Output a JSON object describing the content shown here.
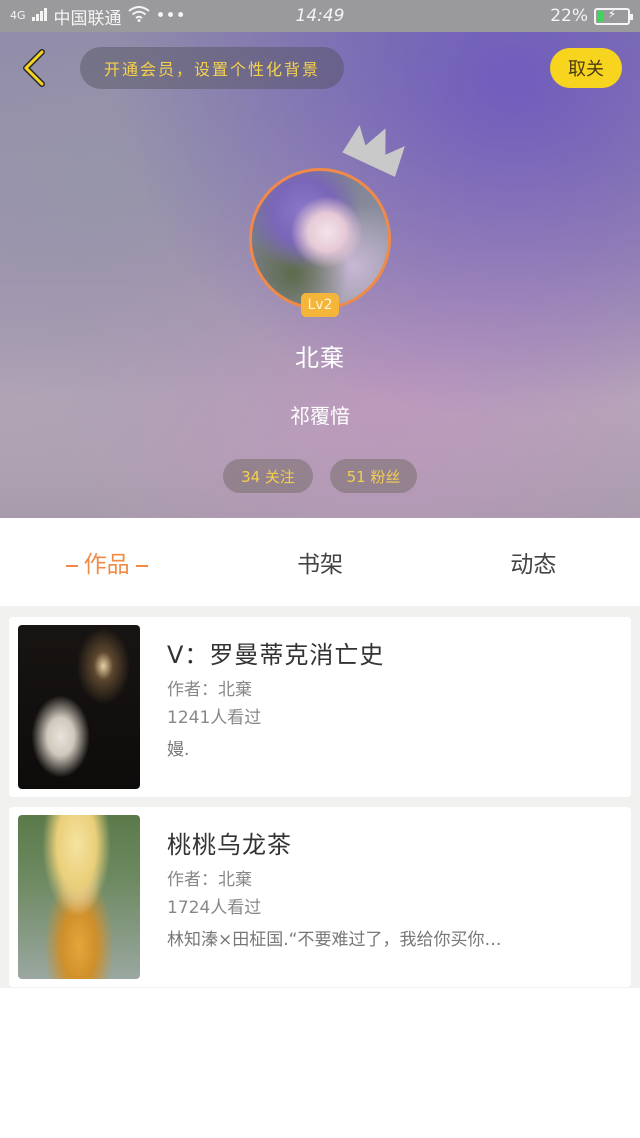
{
  "status_bar": {
    "network": "4G",
    "carrier": "中国联通",
    "more": "•••",
    "time": "14:49",
    "battery_percent": "22%",
    "battery_level": 0.22
  },
  "header": {
    "vip_banner": "开通会员，设置个性化背景",
    "unfollow_label": "取关",
    "level": "Lv2",
    "username": "北棄",
    "signature": "祁覆愔",
    "following": "34 关注",
    "fans": "51 粉丝"
  },
  "tabs": [
    {
      "label": "作品",
      "active": true
    },
    {
      "label": "书架",
      "active": false
    },
    {
      "label": "动态",
      "active": false
    }
  ],
  "works": [
    {
      "title": "V：罗曼蒂克消亡史",
      "author": "作者：北棄",
      "views": "1241人看过",
      "description": "嫚."
    },
    {
      "title": "桃桃乌龙茶",
      "author": "作者：北棄",
      "views": "1724人看过",
      "description": "林知溱×田柾国.“不要难过了，我给你买你…"
    }
  ],
  "colors": {
    "accent_orange": "#f08a44",
    "vip_yellow": "#f7d51e",
    "level_badge": "#f5b53b"
  }
}
